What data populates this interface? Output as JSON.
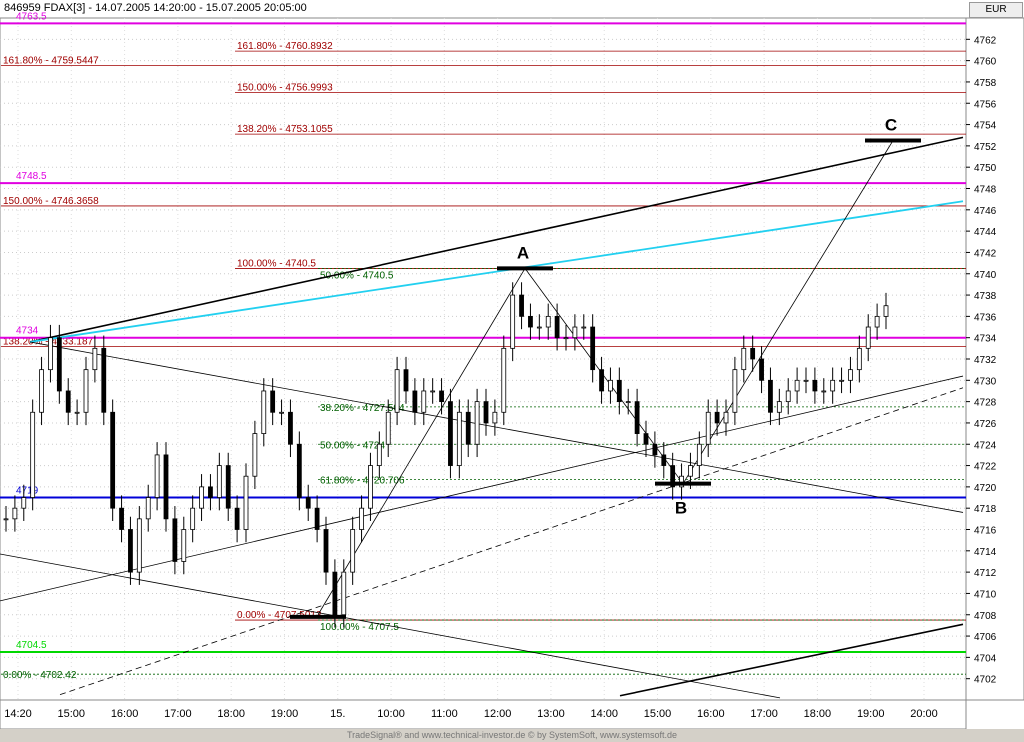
{
  "header": {
    "title": "846959  FDAX[3] - 14.07.2005 14:20:00 - 15.07.2005 20:05:00",
    "currency": "EUR"
  },
  "footer": "TradeSignal® and www.technical-investor.de © by SystemSoft, www.systemsoft.de",
  "chart_data": {
    "type": "candlestick",
    "title": "",
    "ylim": [
      4700,
      4764
    ],
    "yticks": [
      4702,
      4704,
      4706,
      4708,
      4710,
      4712,
      4714,
      4716,
      4718,
      4720,
      4722,
      4724,
      4726,
      4728,
      4730,
      4732,
      4734,
      4736,
      4738,
      4740,
      4742,
      4744,
      4746,
      4748,
      4750,
      4752,
      4754,
      4756,
      4758,
      4760,
      4762
    ],
    "xticks": [
      "14:20",
      "15:00",
      "16:00",
      "17:00",
      "18:00",
      "19:00",
      "15.",
      "10:00",
      "11:00",
      "12:00",
      "13:00",
      "14:00",
      "15:00",
      "16:00",
      "17:00",
      "18:00",
      "19:00",
      "20:00"
    ],
    "series": [
      {
        "values": [
          4717,
          4718,
          4719,
          4727,
          4731,
          4734,
          4729,
          4727,
          4727,
          4731,
          4733,
          4727,
          4718,
          4716,
          4712,
          4717,
          4719,
          4723,
          4717,
          4713,
          4716,
          4718,
          4720,
          4719,
          4722,
          4718,
          4716,
          4721,
          4725,
          4729,
          4727,
          4727,
          4724,
          4719,
          4718,
          4716,
          4712,
          4708,
          4712,
          4716,
          4718,
          4722,
          4724,
          4727,
          4731,
          4729,
          4727,
          4729,
          4729,
          4728,
          4722,
          4727,
          4724,
          4728,
          4726,
          4727,
          4733,
          4738,
          4736,
          4735,
          4735,
          4736,
          4734,
          4734,
          4735,
          4735,
          4731,
          4729,
          4730,
          4728,
          4728,
          4725,
          4724,
          4723,
          4722,
          4720,
          4721,
          4722,
          4724,
          4727,
          4726,
          4727,
          4731,
          4733,
          4732,
          4730,
          4727,
          4728,
          4729,
          4730,
          4730,
          4729,
          4729,
          4730,
          4730,
          4731,
          4733,
          4735,
          4736,
          4737
        ]
      }
    ],
    "levels": [
      {
        "label": "4763.5",
        "value": 4763.5,
        "color": "#e000e0"
      },
      {
        "label": "4748.5",
        "value": 4748.5,
        "color": "#e000e0"
      },
      {
        "label": "4734",
        "value": 4734,
        "color": "#e000e0"
      },
      {
        "label": "4719",
        "value": 4719,
        "color": "#0000d8"
      },
      {
        "label": "4704.5",
        "value": 4704.5,
        "color": "#00d800"
      }
    ],
    "fib_labels": [
      {
        "text": "161.80% - 4760.8932",
        "value": 4760.8932,
        "color": "#a00000"
      },
      {
        "text": "161.80% - 4759.5447",
        "value": 4759.5447,
        "color": "#a00000"
      },
      {
        "text": "150.00% - 4756.9993",
        "value": 4756.9993,
        "color": "#a00000"
      },
      {
        "text": "138.20% - 4753.1055",
        "value": 4753.1055,
        "color": "#a00000"
      },
      {
        "text": "150.00% - 4746.3658",
        "value": 4746.3658,
        "color": "#a00000"
      },
      {
        "text": "100.00% - 4740.5",
        "value": 4740.5,
        "color": "#a00000"
      },
      {
        "text": "50.00% - 4740.5",
        "value": 4740.5,
        "color": "#006000"
      },
      {
        "text": "138.20% - 4733.187",
        "value": 4733.187,
        "color": "#a00000"
      },
      {
        "text": "38.20% - 4727.504",
        "value": 4727.504,
        "color": "#006000"
      },
      {
        "text": "50.00% - 4724",
        "value": 4724,
        "color": "#006000"
      },
      {
        "text": "61.80% - 4720.706",
        "value": 4720.706,
        "color": "#006000"
      },
      {
        "text": "0.00% - 4707.5013",
        "value": 4707.5013,
        "color": "#a00000"
      },
      {
        "text": "100.00% - 4707.5",
        "value": 4707.5,
        "color": "#006000"
      },
      {
        "text": "0.00% - 4702.42",
        "value": 4702.42,
        "color": "#006000"
      }
    ],
    "markers": [
      "A",
      "B",
      "C"
    ]
  }
}
